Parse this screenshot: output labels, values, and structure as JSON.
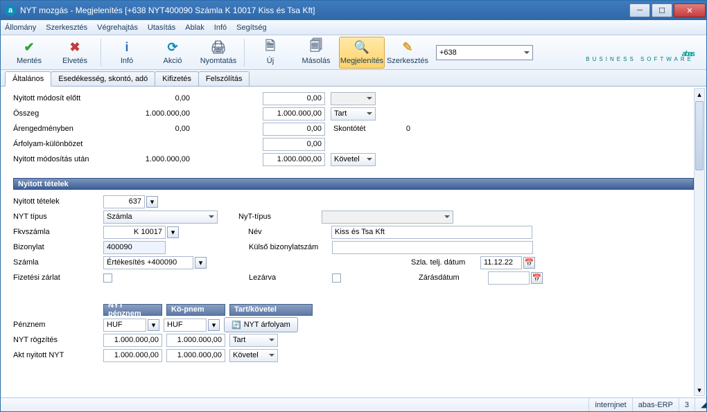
{
  "window": {
    "title": "NYT mozgás - Megjelenítés  [+638  NYT400090   Számla K 10017 Kiss és Tsa Kft]",
    "app_icon_letter": "a"
  },
  "menu": {
    "items": [
      "Állomány",
      "Szerkesztés",
      "Végrehajtás",
      "Utasítás",
      "Ablak",
      "Infó",
      "Segítség"
    ]
  },
  "toolbar": {
    "buttons": [
      {
        "label": "Mentés",
        "icon": "check-icon",
        "color": "#2fa32f"
      },
      {
        "label": "Elvetés",
        "icon": "x-icon",
        "color": "#c43c3c"
      },
      {
        "label": "Infó",
        "icon": "info-icon",
        "color": "#2e6fb5",
        "sep_before": true
      },
      {
        "label": "Akció",
        "icon": "action-icon",
        "color": "#0d8fb5"
      },
      {
        "label": "Nyomtatás",
        "icon": "print-icon",
        "color": "#6b7b90"
      },
      {
        "label": "Új",
        "icon": "new-icon",
        "color": "#6b7b90",
        "sep_before": true
      },
      {
        "label": "Másolás",
        "icon": "copy-icon",
        "color": "#6b7b90"
      },
      {
        "label": "Megjelenítés",
        "icon": "view-icon",
        "color": "#6b7b90",
        "active": true
      },
      {
        "label": "Szerkesztés",
        "icon": "edit-icon",
        "color": "#d8a43a"
      }
    ],
    "combo_value": "+638"
  },
  "logo": {
    "text": "abas",
    "sub": "BUSINESS SOFTWARE"
  },
  "tabs": [
    "Általános",
    "Esedékesség, skontó, adó",
    "Kifizetés",
    "Felszólítás"
  ],
  "active_tab": 0,
  "top_grid": {
    "rows": [
      {
        "label": "Nyitott módosít előtt",
        "c1": "0,00",
        "c2": "0,00",
        "combo": "",
        "combo_disabled": true
      },
      {
        "label": "Összeg",
        "c1": "1.000.000,00",
        "c2": "1.000.000,00",
        "combo": "Tart"
      },
      {
        "label": "Árengedményben",
        "c1": "0,00",
        "c2": "0,00",
        "extra_label": "Skontótét",
        "extra_value": "0"
      },
      {
        "label": "Árfolyam-különbözet",
        "c1": "",
        "c2": "0,00"
      },
      {
        "label": "Nyitott módosítás után",
        "c1": "1.000.000,00",
        "c2": "1.000.000,00",
        "combo": "Követel"
      }
    ]
  },
  "section_open_items": {
    "title": "Nyitott tételek",
    "rows": {
      "nyitott_tetelek_label": "Nyitott tételek",
      "nyitott_tetelek_value": "637",
      "nyt_tipus_label": "NYT típus",
      "nyt_tipus_value": "Számla",
      "nyt_t_tipus_label": "NyT-típus",
      "nyt_t_tipus_value": "",
      "fkvszamla_label": "Fkvszámla",
      "fkvszamla_value": "K 10017",
      "nev_label": "Név",
      "nev_value": "Kiss és Tsa Kft",
      "bizonylat_label": "Bizonylat",
      "bizonylat_value": "400090",
      "kulso_biz_label": "Külső bizonylatszám",
      "kulso_biz_value": "",
      "szamla_label": "Számla",
      "szamla_value": "Értékesítés   +400090",
      "szla_telj_label": "Szla. telj. dátum",
      "szla_telj_value": "11.12.22",
      "fizetesi_zarlat_label": "Fizetési zárlat",
      "lezarva_label": "Lezárva",
      "zarasdatum_label": "Zárásdátum",
      "zarasdatum_value": ""
    }
  },
  "bottom_grid": {
    "head_nyt_penznem": "NYT pénznem",
    "head_ko_pnem": "Kö-pnem",
    "head_tart_kovetel": "Tart/követel",
    "penznem_label": "Pénznem",
    "penznem_v1": "HUF",
    "penznem_v2": "HUF",
    "nyt_arfolyam_btn": "NYT árfolyam",
    "nyt_rogzites_label": "NYT rögzítés",
    "nyt_rogzites_v1": "1.000.000,00",
    "nyt_rogzites_v2": "1.000.000,00",
    "nyt_rogzites_combo": "Tart",
    "akt_nyitott_label": "Akt nyitott NYT",
    "akt_nyitott_v1": "1.000.000,00",
    "akt_nyitott_v2": "1.000.000,00",
    "akt_nyitott_combo": "Követel"
  },
  "status": {
    "cells": [
      "internjnet",
      "abas-ERP",
      "3"
    ]
  }
}
